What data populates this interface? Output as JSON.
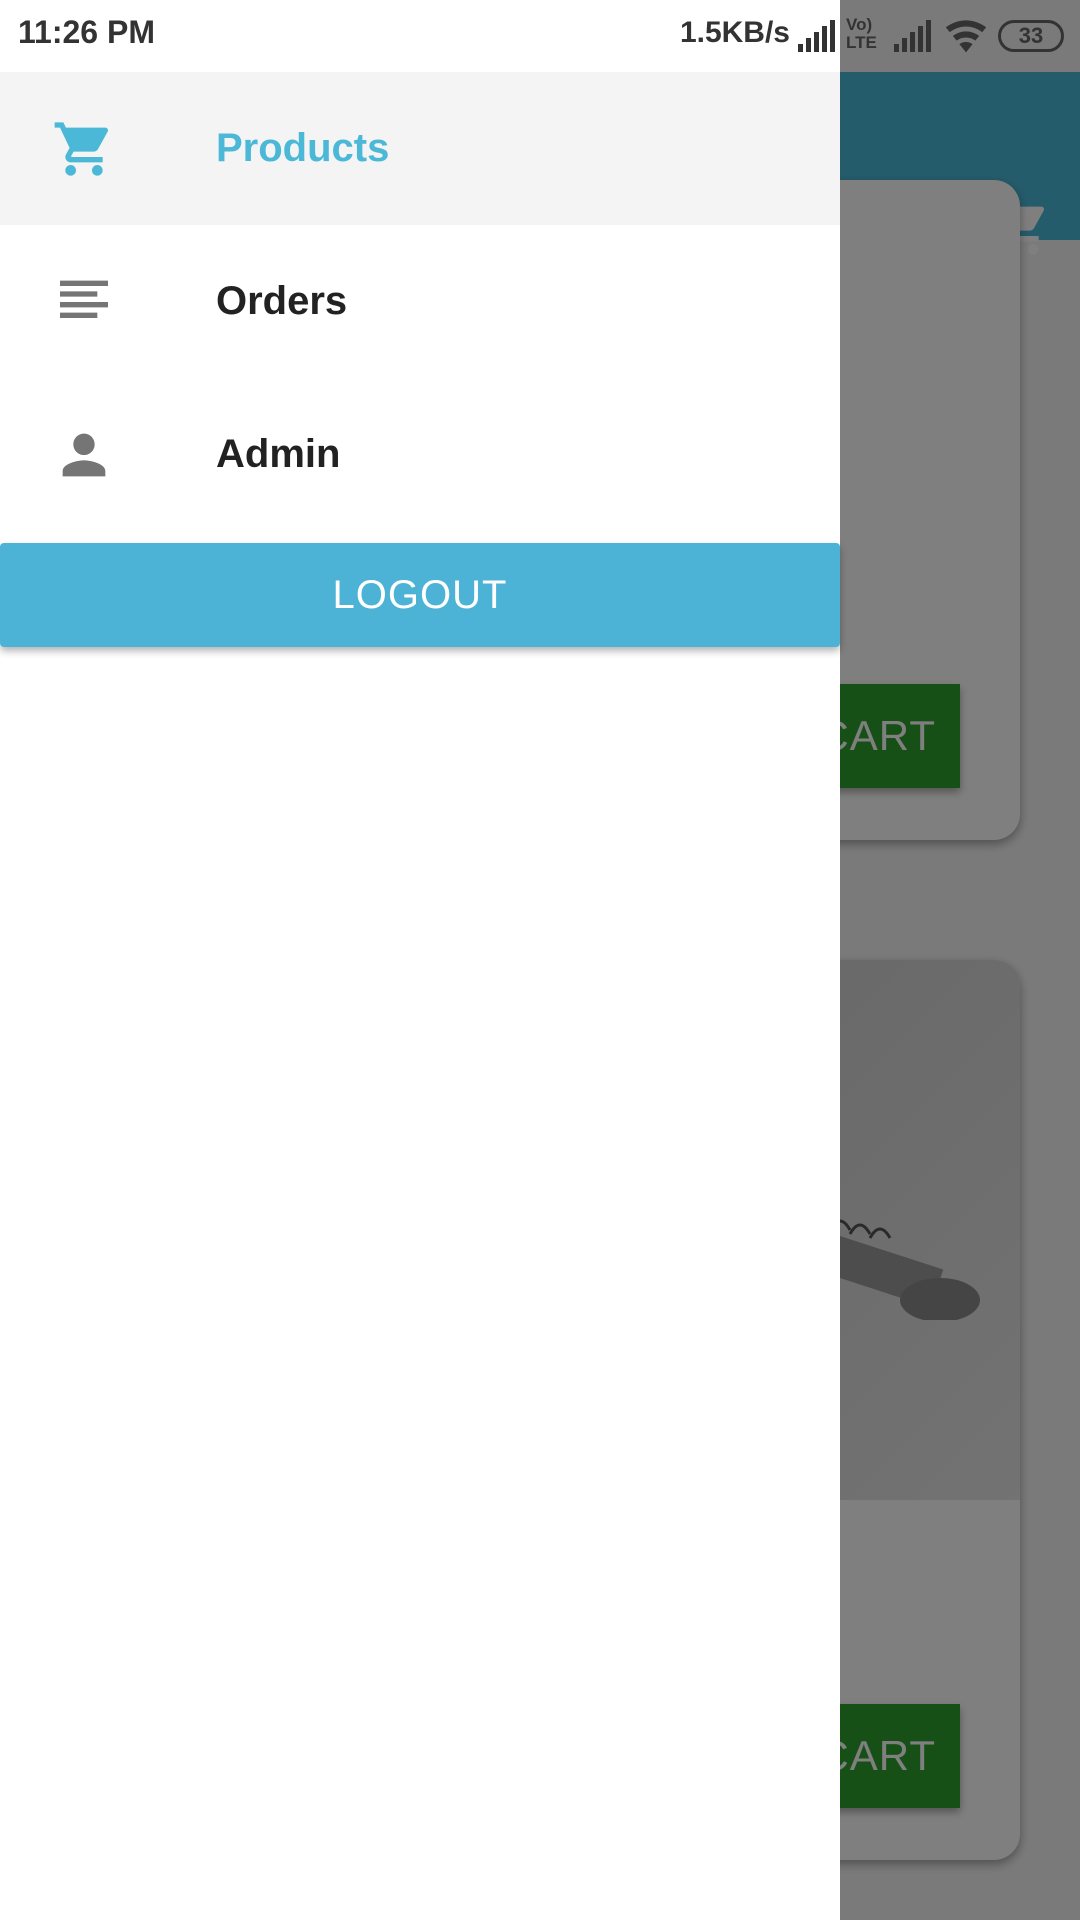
{
  "status_bar": {
    "time": "11:26 PM",
    "net_speed": "1.5KB/s",
    "battery": "33",
    "volte": "Vo) LTE"
  },
  "drawer": {
    "items": [
      {
        "label": "Products",
        "icon": "cart-icon",
        "active": true
      },
      {
        "label": "Orders",
        "icon": "list-icon",
        "active": false
      },
      {
        "label": "Admin",
        "icon": "person-icon",
        "active": false
      }
    ],
    "logout_label": "LOGOUT"
  },
  "background": {
    "add_to_cart_label": "CART",
    "app_bar_icon": "cart-icon"
  },
  "colors": {
    "accent": "#4bb8d7",
    "logout": "#4db3d6",
    "add_to_cart": "#2fa12f"
  }
}
